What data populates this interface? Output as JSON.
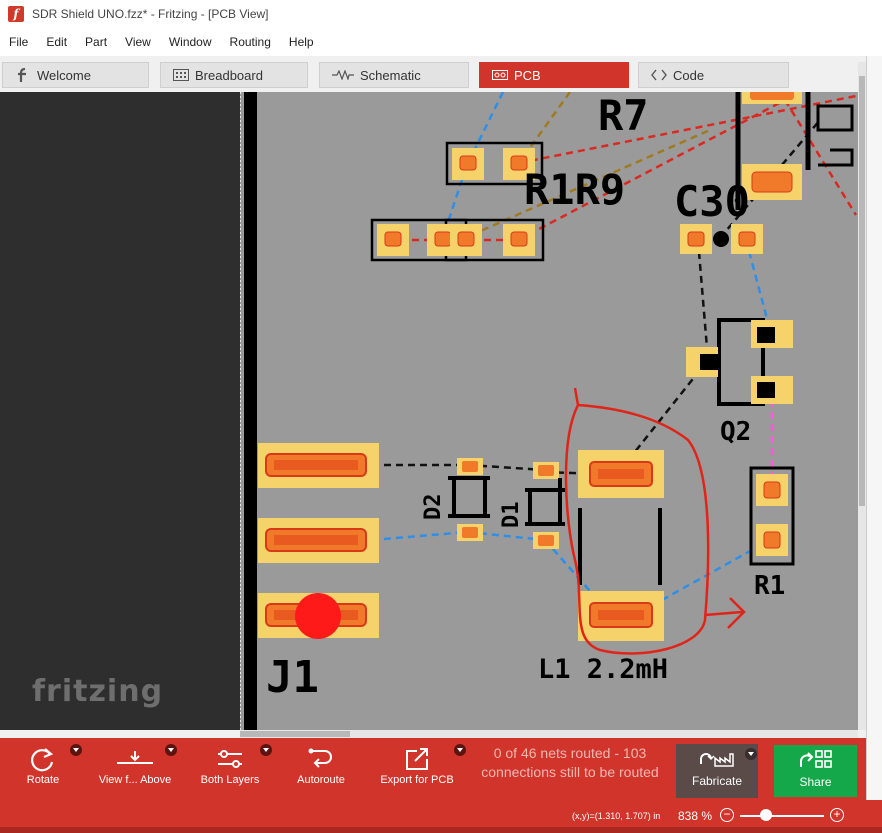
{
  "window": {
    "title": "SDR Shield UNO.fzz* - Fritzing - [PCB View]",
    "app_icon": "f"
  },
  "menu": [
    "File",
    "Edit",
    "Part",
    "View",
    "Window",
    "Routing",
    "Help"
  ],
  "tabs": [
    {
      "label": "Welcome",
      "icon": "fritzing-f-icon"
    },
    {
      "label": "Breadboard",
      "icon": "breadboard-icon"
    },
    {
      "label": "Schematic",
      "icon": "schematic-icon"
    },
    {
      "label": "PCB",
      "icon": "pcb-icon",
      "active": true
    },
    {
      "label": "Code",
      "icon": "code-icon"
    }
  ],
  "brand": {
    "watermark": "fritzing"
  },
  "pcb": {
    "labels": {
      "r7": "R7",
      "r1r9": "R1R9",
      "c30": "C30",
      "q2": "Q2",
      "d2": "D2",
      "d1": "D1",
      "r1": "R1",
      "j1": "J1",
      "l1": "L1 2.2mH"
    }
  },
  "toolbar": {
    "rotate": "Rotate",
    "view_from_above": "View f... Above",
    "both_layers": "Both Layers",
    "autoroute": "Autoroute",
    "export_pcb": "Export for PCB",
    "routing_status": "0 of 46 nets routed - 103 connections still to be routed",
    "fabricate": "Fabricate",
    "share": "Share"
  },
  "status": {
    "coords": "(x,y)=(1.310, 1.707) in",
    "zoom": "838 %"
  },
  "colors": {
    "accent": "#d0342a",
    "board": "#9a9a9a",
    "pad": "#f6d36a",
    "pad_inner": "#f07a2a",
    "ratsnest_blue": "#2f8fe8",
    "ratsnest_red": "#d82a20",
    "ratsnest_black": "#111111",
    "ratsnest_pink": "#ff59d8",
    "annotation": "#e02418",
    "share": "#15a84a"
  }
}
